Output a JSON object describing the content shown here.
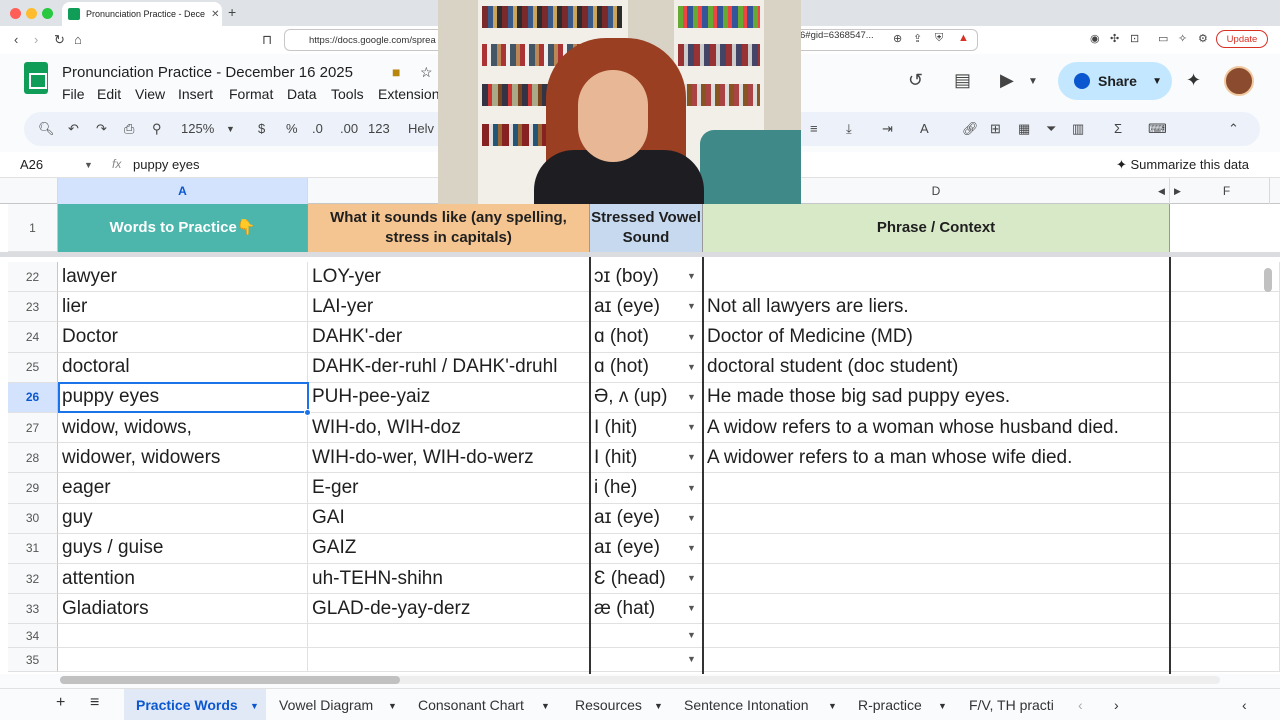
{
  "browser": {
    "tab_title": "Pronunciation Practice - Dece",
    "url_start": "https://docs.google.com/sprea",
    "url_end": "6#gid=6368547...",
    "update_label": "Update"
  },
  "sheets": {
    "doc_title": "Pronunciation Practice - December 16 2025",
    "menu": [
      "File",
      "Edit",
      "View",
      "Insert",
      "Format",
      "Data",
      "Tools",
      "Extension"
    ],
    "share_label": "Share",
    "zoom": "125%",
    "currency": "$",
    "percent": "%",
    "dec_less": ".0",
    "dec_more": ".00",
    "number_format": "123",
    "font_name": "Helv",
    "namebox": "A26",
    "formula": "puppy eyes",
    "summarize_label": "Summarize this data"
  },
  "columns": {
    "a": "A",
    "d": "D",
    "f": "F"
  },
  "headers": {
    "words": "Words to Practice👇",
    "sounds": "What it sounds like (any spelling, stress in capitals)",
    "vowel": "Stressed Vowel Sound",
    "phrase": "Phrase / Context",
    "row_num": "1"
  },
  "rows": [
    {
      "num": "22",
      "word": "lawyer",
      "sound": "LOY-yer",
      "vowel": "ɔɪ (boy)",
      "phrase": ""
    },
    {
      "num": "23",
      "word": "lier",
      "sound": "LAI-yer",
      "vowel": "aɪ (eye)",
      "phrase": "Not all lawyers are liers."
    },
    {
      "num": "24",
      "word": "Doctor",
      "sound": "DAHK'-der",
      "vowel": "ɑ (hot)",
      "phrase": "Doctor of Medicine  (MD)"
    },
    {
      "num": "25",
      "word": "doctoral",
      "sound": "DAHK-der-ruhl / DAHK'-druhl",
      "vowel": "ɑ (hot)",
      "phrase": "doctoral student  (doc student)"
    },
    {
      "num": "26",
      "word": "puppy eyes",
      "sound": "PUH-pee-yaiz",
      "vowel": "Ə, ʌ (up)",
      "phrase": "He made those big sad puppy eyes."
    },
    {
      "num": "27",
      "word": "widow, widows,",
      "sound": "WIH-do, WIH-doz",
      "vowel": "I (hit)",
      "phrase": "A widow refers to a woman whose husband died."
    },
    {
      "num": "28",
      "word": "widower, widowers",
      "sound": "WIH-do-wer, WIH-do-werz",
      "vowel": "I (hit)",
      "phrase": "A widower refers to a man whose wife died."
    },
    {
      "num": "29",
      "word": "eager",
      "sound": "E-ger",
      "vowel": "i (he)",
      "phrase": ""
    },
    {
      "num": "30",
      "word": "guy",
      "sound": "GAI",
      "vowel": "aɪ (eye)",
      "phrase": ""
    },
    {
      "num": "31",
      "word": "guys / guise",
      "sound": "GAIZ",
      "vowel": "aɪ (eye)",
      "phrase": ""
    },
    {
      "num": "32",
      "word": "attention",
      "sound": "uh-TEHN-shihn",
      "vowel": "Ɛ (head)",
      "phrase": ""
    },
    {
      "num": "33",
      "word": "Gladiators",
      "sound": "GLAD-de-yay-derz",
      "vowel": "æ (hat)",
      "phrase": ""
    },
    {
      "num": "34",
      "word": "",
      "sound": "",
      "vowel": "",
      "phrase": ""
    },
    {
      "num": "35",
      "word": "",
      "sound": "",
      "vowel": "",
      "phrase": ""
    }
  ],
  "sheet_tabs": [
    "Practice Words",
    "Vowel Diagram",
    "Consonant Chart",
    "Resources",
    "Sentence Intonation",
    "R-practice",
    "F/V, TH practi"
  ],
  "colors": {
    "header_words": "#4db6ac",
    "header_sounds": "#f5c591",
    "header_vowel": "#c7d9ee",
    "header_phrase": "#d8e9c8",
    "accent": "#0b57d0"
  }
}
